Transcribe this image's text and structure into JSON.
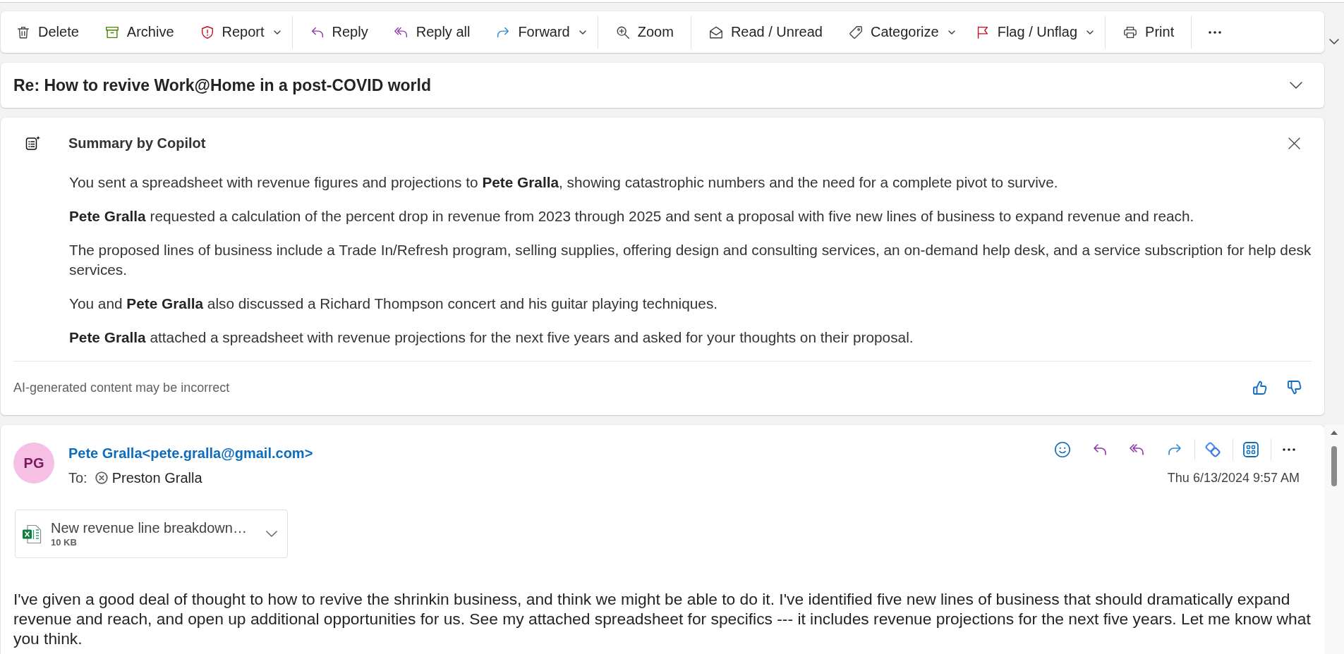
{
  "toolbar": {
    "groups": [
      [
        {
          "label": "Delete",
          "kind": "button"
        },
        {
          "label": "Archive",
          "kind": "button"
        },
        {
          "label": "Report",
          "kind": "split"
        }
      ],
      [
        {
          "label": "Reply",
          "kind": "button"
        },
        {
          "label": "Reply all",
          "kind": "button"
        },
        {
          "label": "Forward",
          "kind": "split"
        }
      ],
      [
        {
          "label": "Zoom",
          "kind": "button"
        }
      ],
      [
        {
          "label": "Read / Unread",
          "kind": "button"
        },
        {
          "label": "Categorize",
          "kind": "split"
        },
        {
          "label": "Flag / Unflag",
          "kind": "split"
        }
      ],
      [
        {
          "label": "Print",
          "kind": "button"
        }
      ],
      [
        {
          "kind": "overflow"
        }
      ]
    ]
  },
  "subject": {
    "text": "Re: How to revive Work@Home in a post-COVID world"
  },
  "copilot_summary": {
    "title": "Summary by Copilot",
    "paragraphs": [
      "You sent a spreadsheet with revenue figures and projections to **Pete Gralla**, showing catastrophic numbers and the need for a complete pivot to survive.",
      "**Pete Gralla** requested a calculation of the percent drop in revenue from 2023 through 2025 and sent a proposal with five new lines of business to expand revenue and reach.",
      "The proposed lines of business include a Trade In/Refresh program, selling supplies, offering design and consulting services, an on-demand help desk, and a service subscription for help desk services.",
      "You and **Pete Gralla** also discussed a Richard Thompson concert and his guitar playing techniques.",
      "**Pete Gralla** attached a spreadsheet with revenue projections for the next five years and asked for your thoughts on their proposal."
    ],
    "disclaimer": "AI-generated content may be incorrect"
  },
  "message": {
    "sender": {
      "initials": "PG",
      "name_and_address": "Pete Gralla<pete.gralla@gmail.com>"
    },
    "to_label": "To:",
    "recipients": [
      "Preston Gralla"
    ],
    "date": "Thu 6/13/2024 9:57 AM",
    "attachments": [
      {
        "name": "New revenue line breakdown…",
        "size": "10 KB"
      }
    ],
    "body": [
      "I've given a good deal of thought to how to revive the shrinkin business, and think we might be able to do it. I've identified five new lines of business that should dramatically expand revenue and reach, and open up additional opportunities for us. See my attached spreadsheet for specifics --- it includes revenue projections for the next five years. Let me know what you think."
    ]
  }
}
